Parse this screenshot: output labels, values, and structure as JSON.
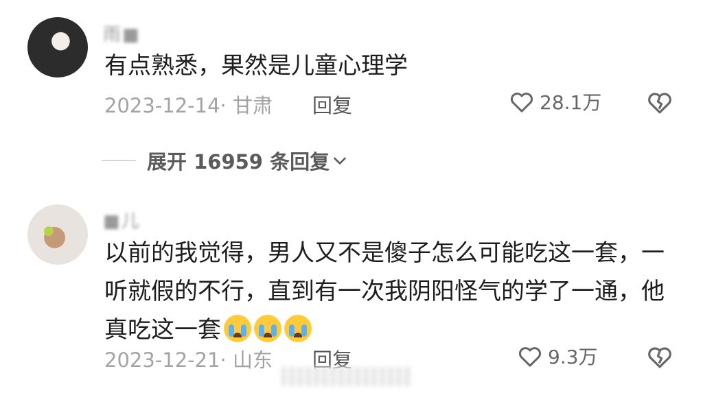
{
  "comments": [
    {
      "username": "雨■",
      "text": "有点熟悉，果然是儿童心理学",
      "date_location": "2023-12-14· 甘肃",
      "reply_label": "回复",
      "likes": "28.1万"
    },
    {
      "username": "■儿",
      "text": "以前的我觉得，男人又不是傻子怎么可能吃这一套，一听就假的不行，直到有一次我阴阳怪气的学了一通，他真吃这一套",
      "date_location": "2023-12-21· 山东",
      "reply_label": "回复",
      "likes": "9.3万"
    }
  ],
  "expand_replies": {
    "label": "展开 16959 条回复"
  },
  "icons": {
    "like": "heart-outline-icon",
    "dislike": "broken-heart-icon",
    "expand": "chevron-down-icon",
    "emoji": "loudly-crying-face-emoji"
  },
  "colors": {
    "text": "#1d1d1d",
    "meta": "#a3a3a3",
    "icon": "#666666"
  }
}
